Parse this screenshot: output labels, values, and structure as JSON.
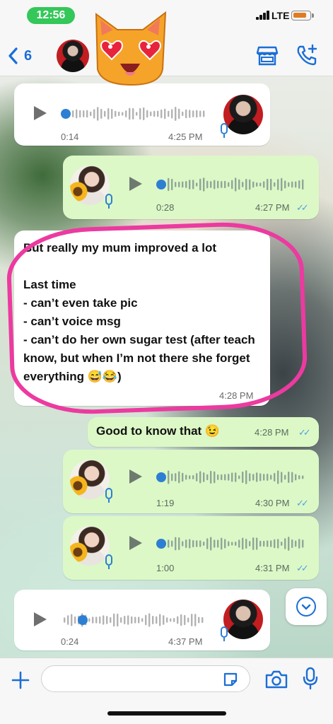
{
  "status_bar": {
    "time": "12:56",
    "network": "LTE",
    "battery_level": 0.8,
    "colors": {
      "time_pill": "#34c759",
      "battery": "#e07b20"
    }
  },
  "header": {
    "back_count": "6",
    "icons": [
      "chevron-left-icon",
      "store-icon",
      "add-call-icon"
    ]
  },
  "messages": [
    {
      "kind": "voice",
      "direction": "incoming",
      "duration": "0:14",
      "time": "4:25 PM"
    },
    {
      "kind": "voice",
      "direction": "outgoing",
      "duration": "0:28",
      "time": "4:27 PM",
      "status": "read"
    },
    {
      "kind": "text",
      "direction": "incoming",
      "text": "But really my mum improved a lot\n\nLast time\n- can’t even take pic\n- can’t voice msg\n- can’t do her own sugar test (after teach know, but when I’m not there she forget everything 😅😂)",
      "time": "4:28 PM",
      "highlighted": true
    },
    {
      "kind": "text",
      "direction": "outgoing",
      "text": "Good to know that 😉",
      "time": "4:28 PM",
      "status": "read"
    },
    {
      "kind": "voice",
      "direction": "outgoing",
      "duration": "1:19",
      "time": "4:30 PM",
      "status": "read"
    },
    {
      "kind": "voice",
      "direction": "outgoing",
      "duration": "1:00",
      "time": "4:31 PM",
      "status": "read"
    },
    {
      "kind": "voice",
      "direction": "incoming",
      "duration": "0:24",
      "time": "4:37 PM"
    }
  ],
  "composer": {
    "placeholder": "",
    "icons": [
      "plus-icon",
      "sticker-icon",
      "camera-icon",
      "microphone-icon"
    ]
  },
  "colors": {
    "accent": "#1b6ed6",
    "outgoing_bubble": "#dcf8c6",
    "incoming_bubble": "#ffffff",
    "highlight_ring": "#ec3aa0"
  }
}
